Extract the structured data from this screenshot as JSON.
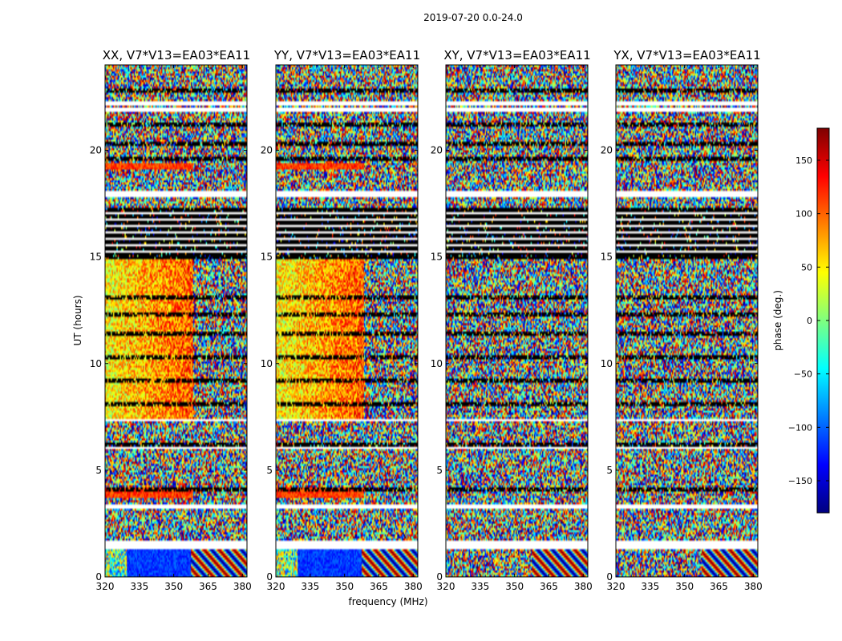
{
  "figure": {
    "suptitle": "2019-07-20 0.0-24.0",
    "ylabel": "UT (hours)",
    "xlabel": "frequency (MHz)"
  },
  "chart_data": [
    {
      "type": "heatmap",
      "title": "XX, V7*V13=EA03*EA11",
      "xlim": [
        320,
        382
      ],
      "ylim": [
        0,
        24
      ],
      "x_ticks": [
        "320",
        "335",
        "350",
        "365",
        "380"
      ],
      "y_ticks": [
        "0",
        "5",
        "10",
        "15",
        "20"
      ],
      "pattern": "parallel"
    },
    {
      "type": "heatmap",
      "title": "YY, V7*V13=EA03*EA11",
      "xlim": [
        320,
        382
      ],
      "ylim": [
        0,
        24
      ],
      "x_ticks": [
        "320",
        "335",
        "350",
        "365",
        "380"
      ],
      "y_ticks": [
        "0",
        "5",
        "10",
        "15",
        "20"
      ],
      "pattern": "parallel"
    },
    {
      "type": "heatmap",
      "title": "XY, V7*V13=EA03*EA11",
      "xlim": [
        320,
        382
      ],
      "ylim": [
        0,
        24
      ],
      "x_ticks": [
        "320",
        "335",
        "350",
        "365",
        "380"
      ],
      "y_ticks": [
        "0",
        "5",
        "10",
        "15",
        "20"
      ],
      "pattern": "cross"
    },
    {
      "type": "heatmap",
      "title": "YX, V7*V13=EA03*EA11",
      "xlim": [
        320,
        382
      ],
      "ylim": [
        0,
        24
      ],
      "x_ticks": [
        "320",
        "335",
        "350",
        "365",
        "380"
      ],
      "y_ticks": [
        "0",
        "5",
        "10",
        "15",
        "20"
      ],
      "pattern": "cross"
    }
  ],
  "colorbar": {
    "label": "phase (deg.)",
    "range": [
      -180,
      180
    ],
    "ticks": [
      "150",
      "100",
      "50",
      "0",
      "−50",
      "−100",
      "−150"
    ],
    "colormap": "jet"
  }
}
